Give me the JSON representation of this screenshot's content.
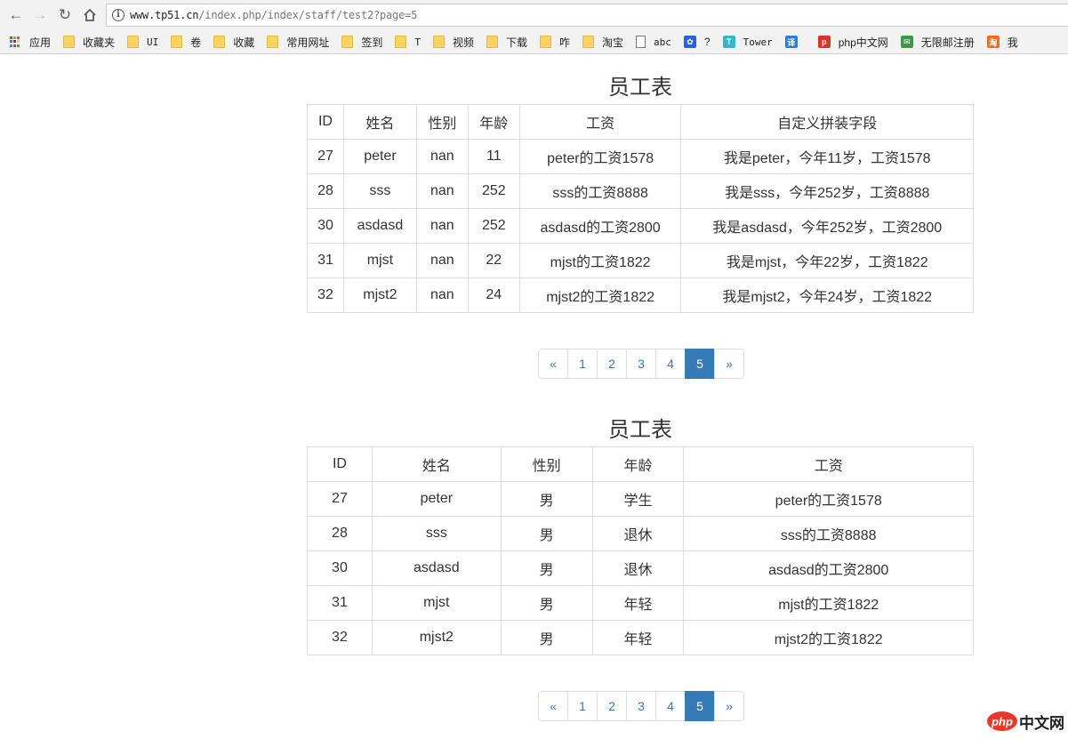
{
  "browser": {
    "url_host": "www.tp51.cn",
    "url_path": "/index.php/index/staff/test2?page=5",
    "bookmarks": [
      {
        "label": "应用",
        "icon": "apps-icon"
      },
      {
        "label": "收藏夹",
        "icon": "folder-icon"
      },
      {
        "label": "UI",
        "icon": "folder-icon"
      },
      {
        "label": "卷",
        "icon": "folder-icon"
      },
      {
        "label": "收藏",
        "icon": "folder-icon"
      },
      {
        "label": "常用网址",
        "icon": "folder-icon"
      },
      {
        "label": "签到",
        "icon": "folder-icon"
      },
      {
        "label": "T",
        "icon": "folder-icon"
      },
      {
        "label": "视频",
        "icon": "folder-icon"
      },
      {
        "label": "下载",
        "icon": "folder-icon"
      },
      {
        "label": "咋",
        "icon": "folder-icon"
      },
      {
        "label": "淘宝",
        "icon": "folder-icon"
      },
      {
        "label": "abc",
        "icon": "page-icon"
      },
      {
        "label": "?",
        "icon": "baidu-paw-icon"
      },
      {
        "label": "Tower",
        "icon": "tower-icon"
      },
      {
        "label": "",
        "icon": "translate-icon"
      },
      {
        "label": "php中文网",
        "icon": "php-icon"
      },
      {
        "label": "无限邮注册",
        "icon": "mail-icon"
      },
      {
        "label": "我",
        "icon": "taobao-icon"
      }
    ]
  },
  "table1": {
    "title": "员工表",
    "headers": [
      "ID",
      "姓名",
      "性别",
      "年龄",
      "工资",
      "自定义拼装字段"
    ],
    "rows": [
      [
        "27",
        "peter",
        "nan",
        "11",
        "peter的工资1578",
        "我是peter，今年11岁，工资1578"
      ],
      [
        "28",
        "sss",
        "nan",
        "252",
        "sss的工资8888",
        "我是sss，今年252岁，工资8888"
      ],
      [
        "30",
        "asdasd",
        "nan",
        "252",
        "asdasd的工资2800",
        "我是asdasd，今年252岁，工资2800"
      ],
      [
        "31",
        "mjst",
        "nan",
        "22",
        "mjst的工资1822",
        "我是mjst，今年22岁，工资1822"
      ],
      [
        "32",
        "mjst2",
        "nan",
        "24",
        "mjst2的工资1822",
        "我是mjst2，今年24岁，工资1822"
      ]
    ]
  },
  "pagination1": {
    "prev": "«",
    "pages": [
      "1",
      "2",
      "3",
      "4",
      "5"
    ],
    "active": "5",
    "next": "»"
  },
  "table2": {
    "title": "员工表",
    "headers": [
      "ID",
      "姓名",
      "性别",
      "年龄",
      "工资"
    ],
    "rows": [
      [
        "27",
        "peter",
        "男",
        "学生",
        "peter的工资1578"
      ],
      [
        "28",
        "sss",
        "男",
        "退休",
        "sss的工资8888"
      ],
      [
        "30",
        "asdasd",
        "男",
        "退休",
        "asdasd的工资2800"
      ],
      [
        "31",
        "mjst",
        "男",
        "年轻",
        "mjst的工资1822"
      ],
      [
        "32",
        "mjst2",
        "男",
        "年轻",
        "mjst2的工资1822"
      ]
    ]
  },
  "pagination2": {
    "prev": "«",
    "pages": [
      "1",
      "2",
      "3",
      "4",
      "5"
    ],
    "active": "5",
    "next": "»"
  },
  "watermark": {
    "logo": "php",
    "text": "中文网"
  },
  "colors": {
    "link": "#337ab7",
    "active_page_bg": "#337ab7",
    "table_border": "#dddddd"
  }
}
